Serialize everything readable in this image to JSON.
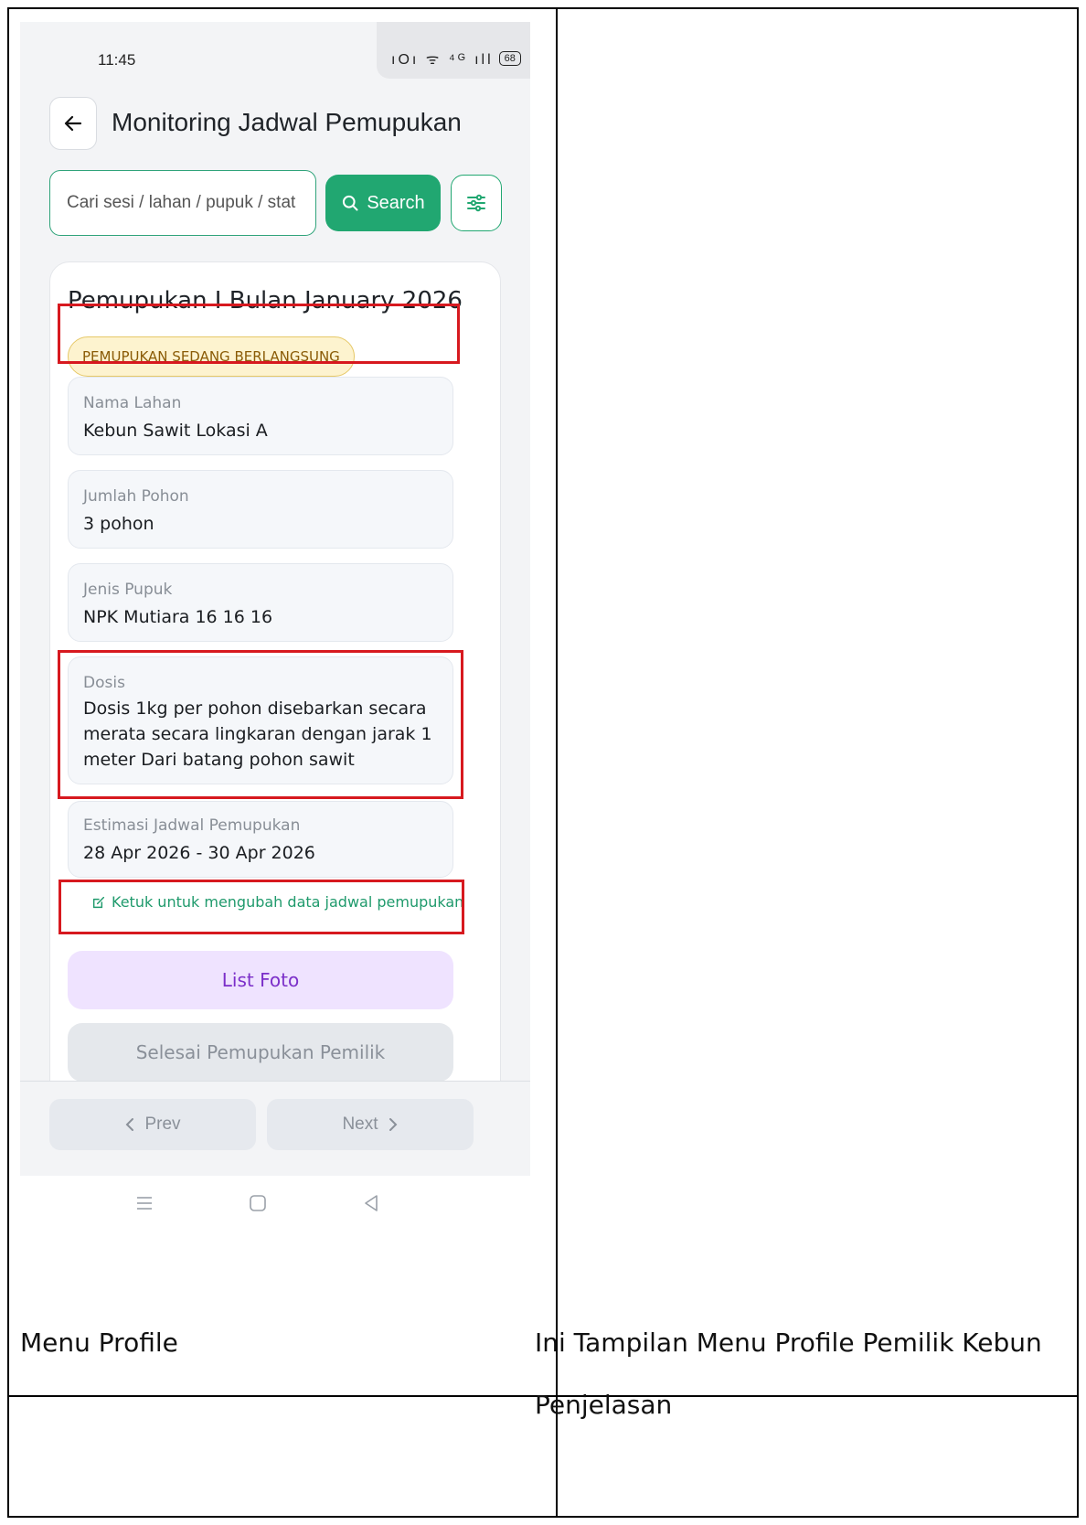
{
  "status_bar": {
    "time": "11:45",
    "icons": "ıOı ᯤ ⁴ᴳ ıll",
    "battery": "68"
  },
  "header": {
    "title": "Monitoring Jadwal Pemupukan"
  },
  "search": {
    "placeholder": "Cari sesi / lahan / pupuk / stat",
    "button_label": "Search"
  },
  "card": {
    "title": "Pemupukan I Bulan January 2026",
    "status_badge": "PEMUPUKAN SEDANG BERLANGSUNG",
    "fields": [
      {
        "label": "Nama Lahan",
        "value": "Kebun Sawit Lokasi A"
      },
      {
        "label": "Jumlah Pohon",
        "value": "3 pohon"
      },
      {
        "label": "Jenis Pupuk",
        "value": "NPK Mutiara 16 16 16"
      },
      {
        "label": "Dosis",
        "value": "Dosis 1kg per pohon disebarkan secara merata secara lingkaran dengan jarak 1 meter Dari batang pohon sawit"
      },
      {
        "label": "Estimasi Jadwal Pemupukan",
        "value": "28 Apr 2026 - 30 Apr 2026"
      }
    ],
    "edit_link": "Ketuk untuk mengubah data jadwal pemupukan",
    "list_foto_label": "List Foto",
    "selesai_label": "Selesai Pemupukan Pemilik"
  },
  "pagination": {
    "prev_label": "Prev",
    "next_label": "Next"
  },
  "document": {
    "left_cell": "Menu Profile",
    "right_line1": "Ini Tampilan Menu Profile Pemilik Kebun",
    "right_line2": "Penjelasan"
  },
  "colors": {
    "accent_green": "#21a771",
    "badge_bg": "#fdf3cf",
    "badge_text": "#8a5b06",
    "list_foto_bg": "#efe3ff",
    "list_foto_text": "#7b2fc9",
    "annotation_red": "#d7191f"
  }
}
